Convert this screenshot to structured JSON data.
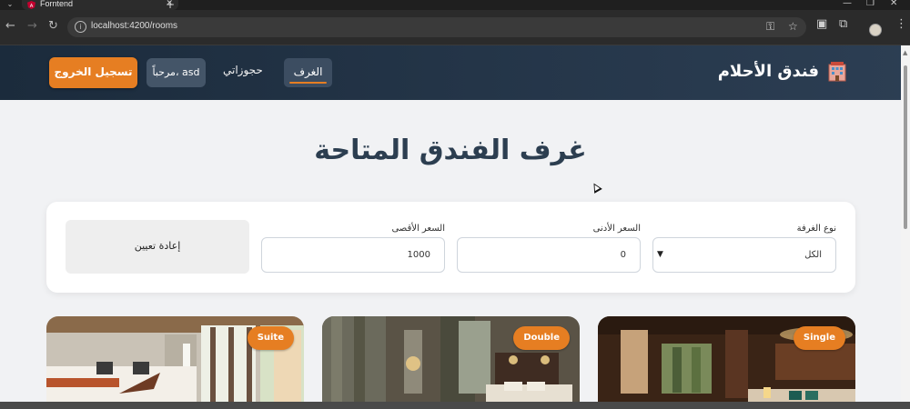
{
  "browser": {
    "tab_title": "Forntend",
    "url": "localhost:4200/rooms",
    "tab_close": "✕",
    "new_tab": "+",
    "window_controls": [
      "—",
      "❐",
      "✕"
    ]
  },
  "header": {
    "brand_name": "فندق الأحلام",
    "nav_rooms": "الغرف",
    "nav_bookings": "حجوزاتي",
    "welcome": "مرحباً، asd",
    "logout": "تسجيل الخروج"
  },
  "main": {
    "title": "غرف الفندق المتاحة"
  },
  "filters": {
    "room_type_label": "نوع الغرفة",
    "room_type_value": "الكل",
    "min_price_label": "السعر الأدنى",
    "min_price_value": "0",
    "max_price_label": "السعر الأقصى",
    "max_price_value": "1000",
    "reset_label": "إعادة تعيين"
  },
  "rooms": [
    {
      "type": "Single"
    },
    {
      "type": "Double"
    },
    {
      "type": "Suite"
    }
  ],
  "colors": {
    "accent": "#e67e22",
    "header_dark": "#1b2b3c",
    "title": "#2c3e50"
  }
}
